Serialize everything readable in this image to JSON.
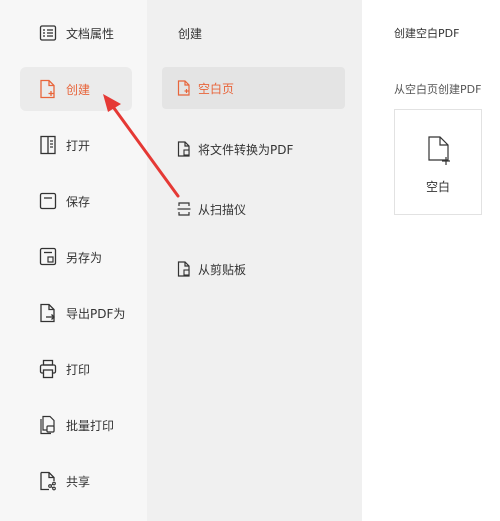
{
  "sidebar": {
    "items": [
      {
        "label": "文档属性",
        "icon": "document-properties-icon"
      },
      {
        "label": "创建",
        "icon": "create-icon",
        "active": true
      },
      {
        "label": "打开",
        "icon": "open-icon"
      },
      {
        "label": "保存",
        "icon": "save-icon"
      },
      {
        "label": "另存为",
        "icon": "save-as-icon"
      },
      {
        "label": "导出PDF为",
        "icon": "export-pdf-icon"
      },
      {
        "label": "打印",
        "icon": "print-icon"
      },
      {
        "label": "批量打印",
        "icon": "batch-print-icon"
      },
      {
        "label": "共享",
        "icon": "share-icon"
      }
    ]
  },
  "create_panel": {
    "title": "创建",
    "options": [
      {
        "label": "空白页",
        "icon": "blank-page-icon",
        "active": true
      },
      {
        "label": "将文件转换为PDF",
        "icon": "convert-file-icon"
      },
      {
        "label": "从扫描仪",
        "icon": "scanner-icon"
      },
      {
        "label": "从剪贴板",
        "icon": "clipboard-icon"
      }
    ]
  },
  "detail_panel": {
    "title": "创建空白PDF",
    "subtitle": "从空白页创建PDF",
    "card_label": "空白"
  },
  "colors": {
    "accent": "#e8653b",
    "arrow": "#e53935"
  }
}
